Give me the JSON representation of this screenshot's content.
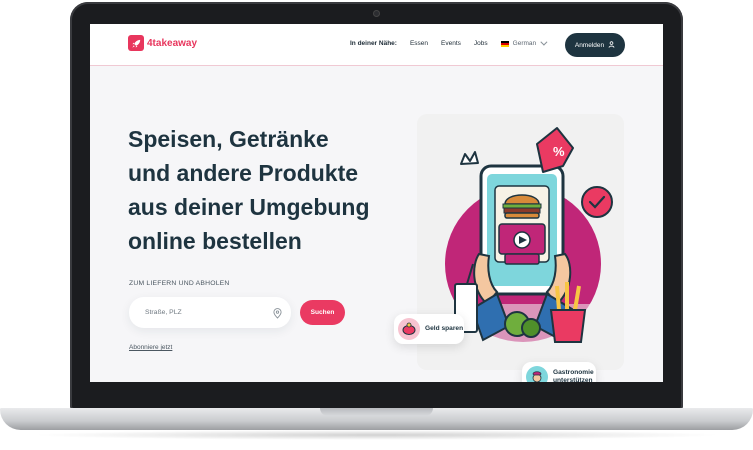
{
  "header": {
    "logo_text": "4takeaway",
    "nav_nearby": "In deiner Nähe:",
    "nav_links": [
      "Essen",
      "Events",
      "Jobs"
    ],
    "language": "German",
    "login_label": "Anmelden"
  },
  "hero": {
    "title_lines": [
      "Speisen, Getränke",
      "und andere Produkte",
      "aus deiner Umgebung",
      "online bestellen"
    ],
    "sub_label": "ZUM LIEFERN UND ABHOLEN",
    "search_placeholder": "Straße, PLZ",
    "search_button": "Suchen",
    "subscribe_link": "Abonniere jetzt"
  },
  "badges": {
    "save": "Geld sparen",
    "gastro": "Gastronomie unterstützen"
  },
  "colors": {
    "brand": "#e8365d",
    "dark": "#1e3440",
    "magenta": "#c02678"
  },
  "icons": [
    "rocket-icon",
    "user-icon",
    "chevron-down-icon",
    "location-pin-icon",
    "play-icon",
    "percent-tag-icon",
    "check-bubble-icon",
    "crown-icon"
  ]
}
